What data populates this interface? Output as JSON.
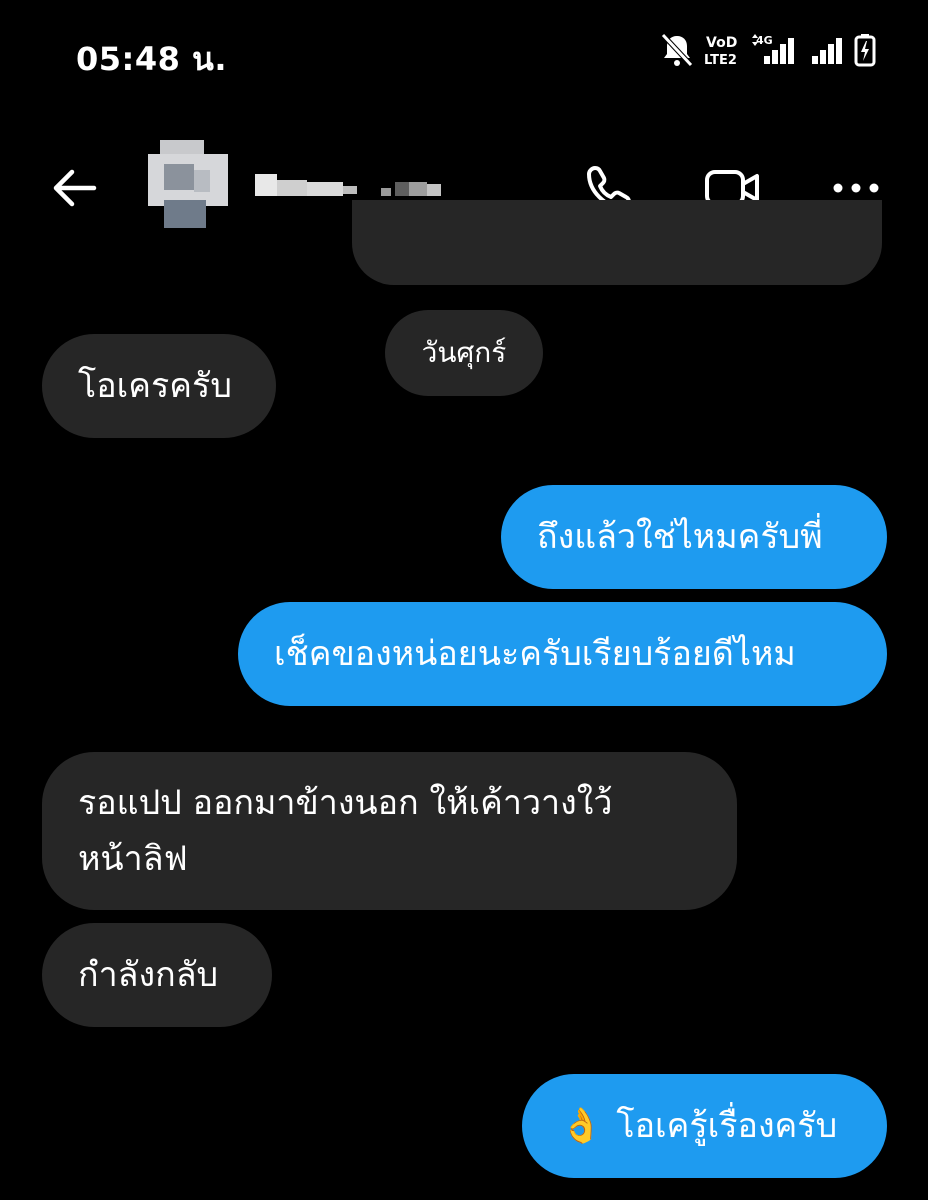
{
  "status_bar": {
    "time": "05:48 น.",
    "icons": [
      "mute-icon",
      "volte-icon",
      "4g-signal-icon",
      "signal-icon",
      "battery-charging-icon"
    ]
  },
  "header": {
    "icons": [
      "back-arrow-icon",
      "phone-icon",
      "video-camera-icon",
      "more-icon"
    ]
  },
  "date_separator": "วันศุกร์",
  "messages": [
    {
      "side": "in",
      "text": "โอเครครับ"
    },
    {
      "side": "out",
      "text": "ถึงแล้วใช่ไหมครับพี่"
    },
    {
      "side": "out",
      "text": "เช็คของหน่อยนะครับเรียบร้อยดีไหม"
    },
    {
      "side": "in",
      "line1": "รอแปป ออกมาข้างนอก ให้เค้าวางใว้",
      "line2": "หน้าลิฟ"
    },
    {
      "side": "in",
      "text": "กำลังกลับ"
    },
    {
      "side": "out",
      "emoji": "👌",
      "text": "โอเครู้เรื่องครับ"
    }
  ],
  "colors": {
    "background": "#000000",
    "incoming": "#262626",
    "outgoing": "#1e9bf0"
  }
}
